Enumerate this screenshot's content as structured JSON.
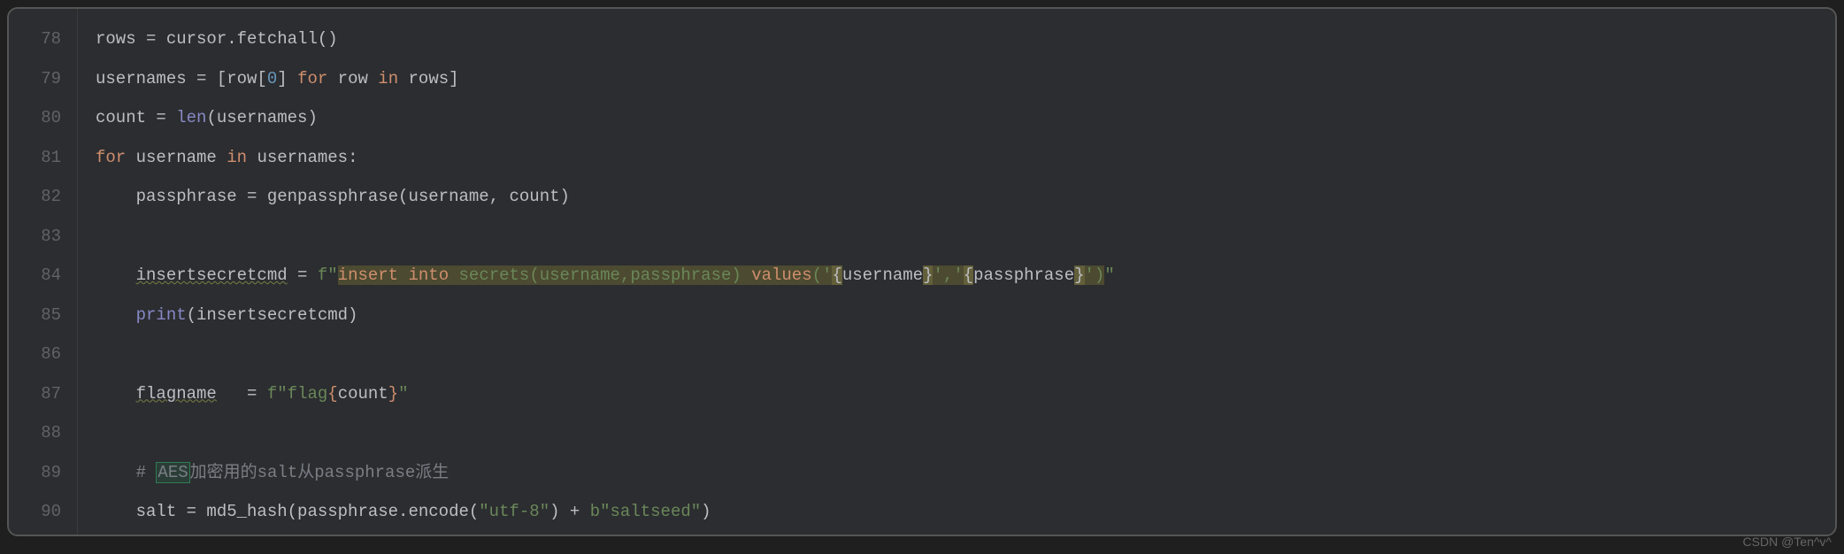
{
  "editor": {
    "line_start": 78,
    "line_end": 90,
    "gutter": [
      "78",
      "79",
      "80",
      "81",
      "82",
      "83",
      "84",
      "85",
      "86",
      "87",
      "88",
      "89",
      "90"
    ]
  },
  "code": {
    "l78": {
      "a": "rows = cursor.fetchall()"
    },
    "l79": {
      "a": "usernames = [row[",
      "n": "0",
      "b": "] ",
      "k1": "for",
      "c": " row ",
      "k2": "in",
      "d": " rows]"
    },
    "l80": {
      "a": "count = ",
      "fn": "len",
      "b": "(usernames)"
    },
    "l81": {
      "k1": "for",
      "a": " username ",
      "k2": "in",
      "b": " usernames:"
    },
    "l82": {
      "a": "    passphrase = genpassphrase(username",
      "c": ", ",
      "b": "count)"
    },
    "l83": {
      "a": ""
    },
    "l84": {
      "a": "    ",
      "warn": "insertsecretcmd",
      "b": " = ",
      "pre": "f\"",
      "sk1": "insert",
      "sp1": " ",
      "sk2": "into",
      "sp2": " ",
      "st1": "secrets(",
      "p1": "username",
      "sc": ",",
      "p2": "passphrase",
      "st2": ") ",
      "sk3": "values",
      "st3": "('",
      "br1": "{",
      "v1": "username",
      "br2": "}",
      "st4": "','",
      "br3": "{",
      "v2": "passphrase",
      "br4": "}",
      "st5": "')",
      "end": "\""
    },
    "l85": {
      "a": "    ",
      "fn": "print",
      "b": "(insertsecretcmd)"
    },
    "l86": {
      "a": ""
    },
    "l87": {
      "a": "    ",
      "warn": "flagname",
      "sp": "   ",
      "b": "= ",
      "pre": "f\"",
      "s1": "flag",
      "br1": "{",
      "v": "count",
      "br2": "}",
      "end": "\""
    },
    "l88": {
      "a": ""
    },
    "l89": {
      "a": "    ",
      "hash": "# ",
      "sel": "AES",
      "cmt": "加密用的salt从passphrase派生"
    },
    "l90": {
      "a": "    salt = md5_hash(passphrase.encode(",
      "s1": "\"utf-8\"",
      "b": ") + ",
      "pre": "b",
      "s2": "\"saltseed\"",
      "c": ")"
    }
  },
  "watermark": "CSDN @Ten^v^"
}
